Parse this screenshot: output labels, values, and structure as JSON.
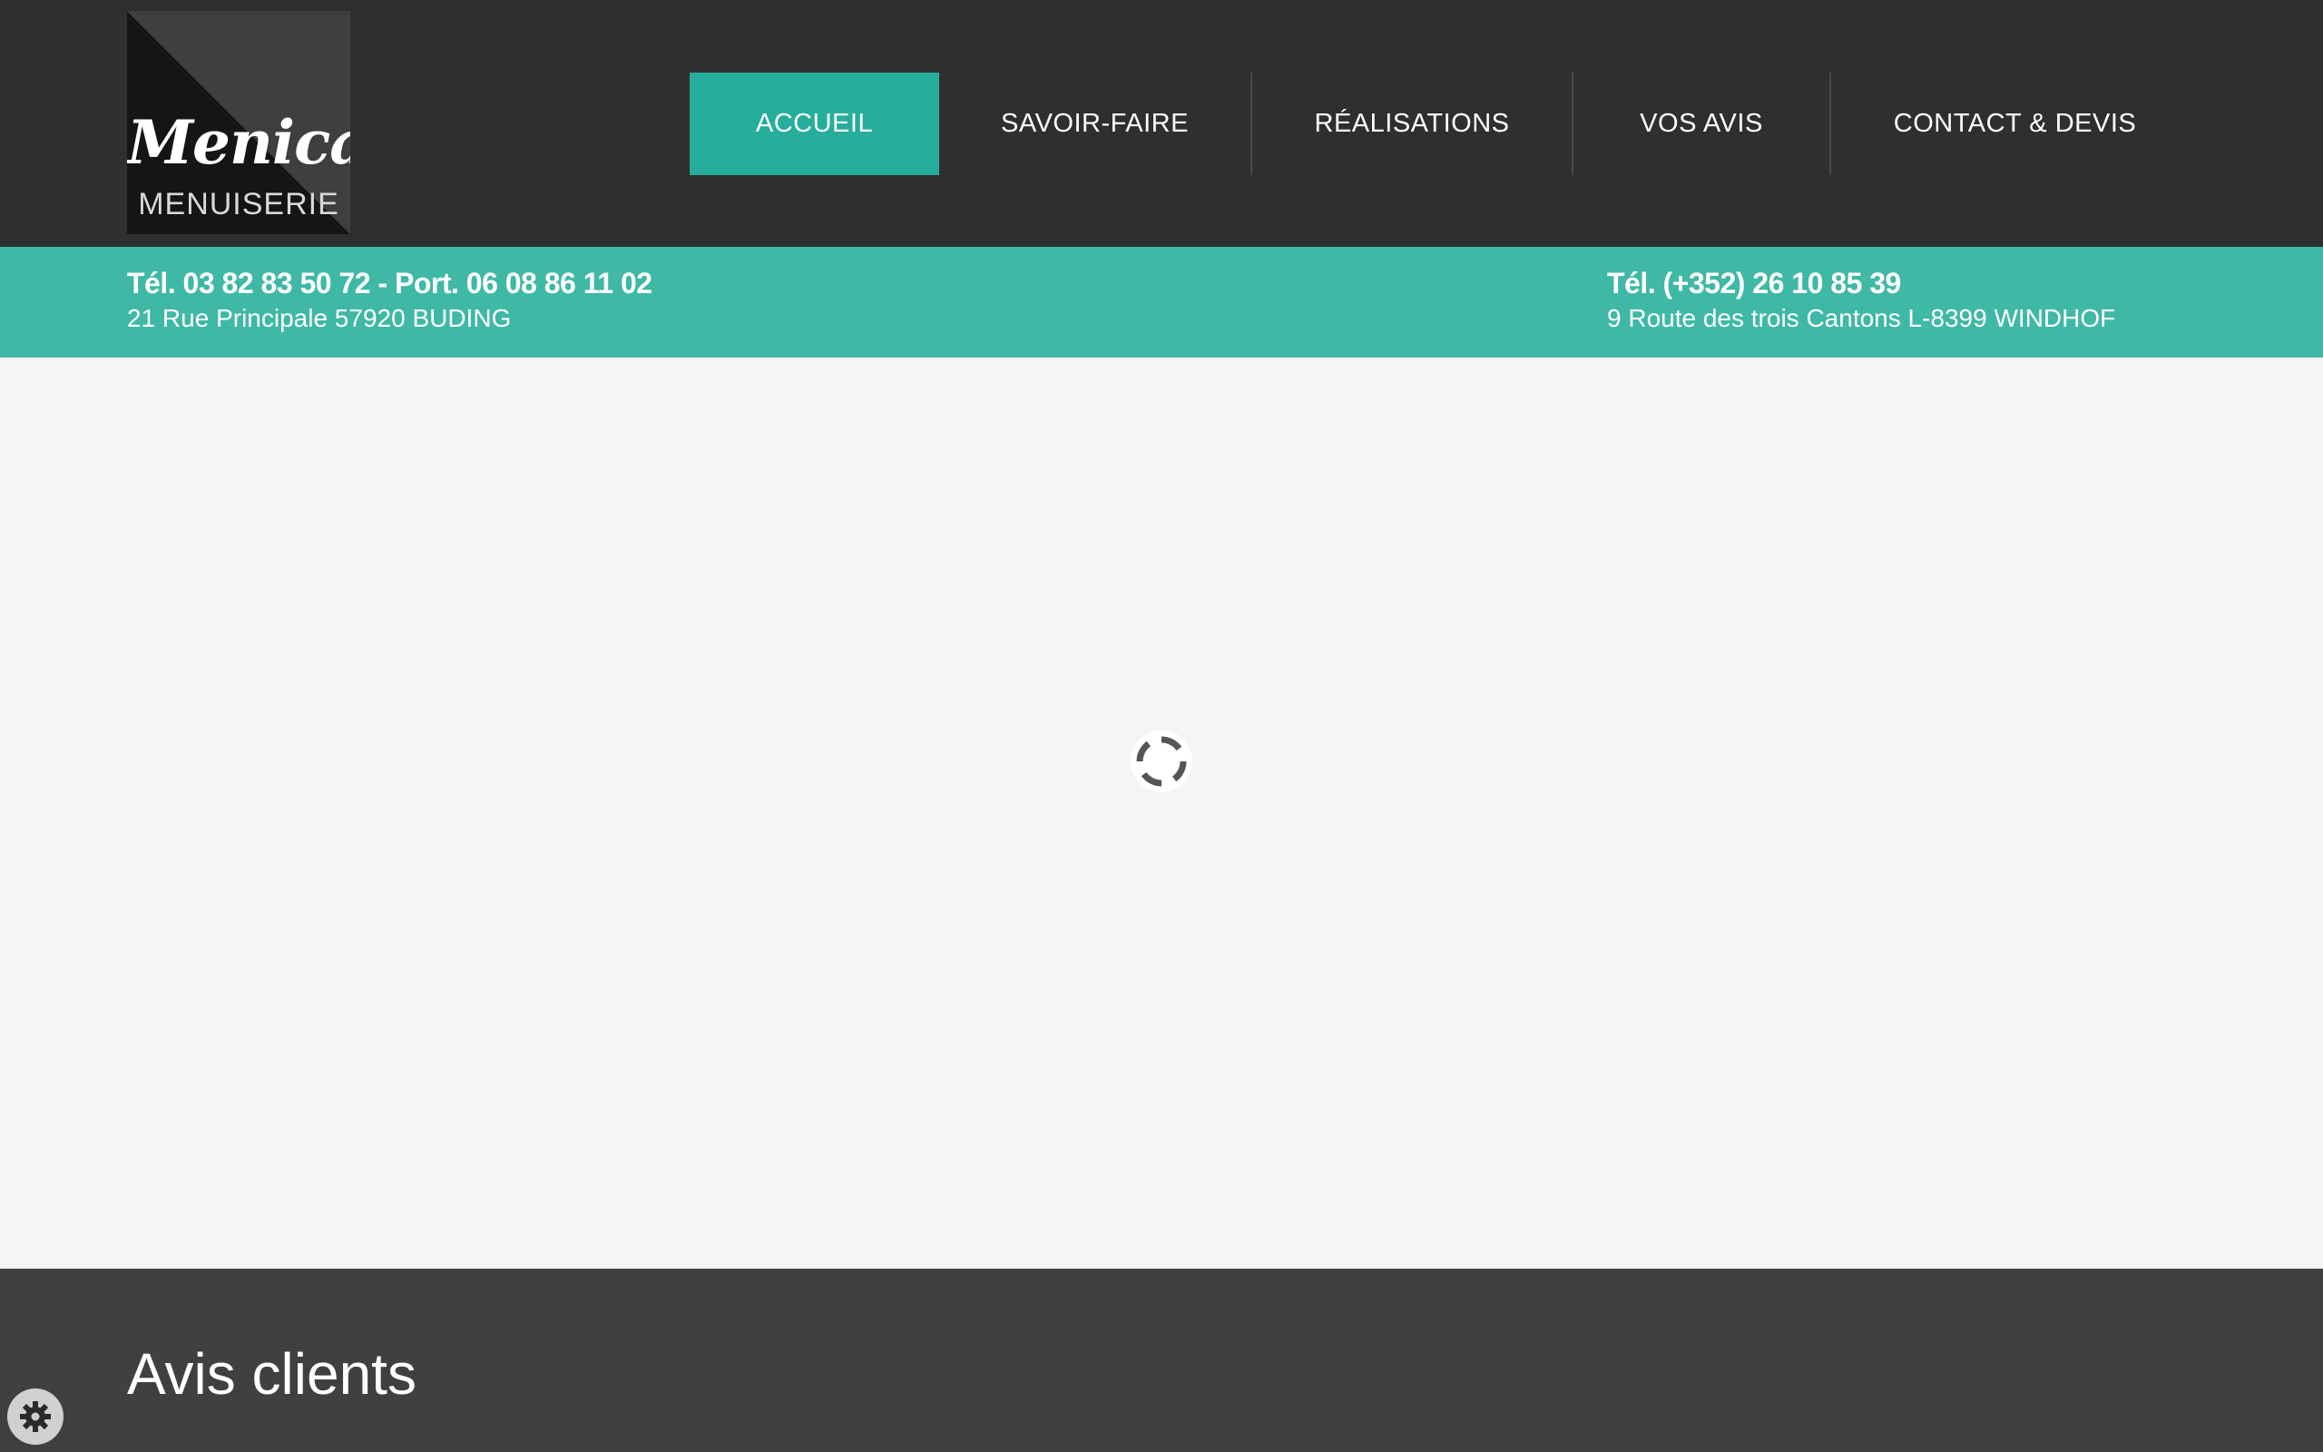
{
  "logo": {
    "script": "Menica",
    "subtitle": "MENUISERIE"
  },
  "nav": {
    "items": [
      {
        "label": "ACCUEIL",
        "active": true
      },
      {
        "label": "SAVOIR-FAIRE",
        "active": false
      },
      {
        "label": "RÉALISATIONS",
        "active": false
      },
      {
        "label": "VOS AVIS",
        "active": false
      },
      {
        "label": "CONTACT & DEVIS",
        "active": false
      }
    ]
  },
  "contact": {
    "france": {
      "phone": "Tél. 03 82 83 50 72 - Port. 06 08 86 11 02",
      "address": "21 Rue Principale 57920 BUDING"
    },
    "luxembourg": {
      "phone": "Tél. (+352) 26 10 85 39",
      "address": "9 Route des trois Cantons L-8399 WINDHOF"
    }
  },
  "hero": {
    "loading_icon": "spinner-icon"
  },
  "reviews": {
    "title": "Avis clients"
  },
  "cookie": {
    "icon": "gear-icon"
  },
  "colors": {
    "header_bg": "#2f2f2f",
    "accent": "#27ad9b",
    "infobar_bg": "#40b8a6",
    "hero_bg": "#f3f4f4",
    "reviews_bg": "#404040"
  }
}
